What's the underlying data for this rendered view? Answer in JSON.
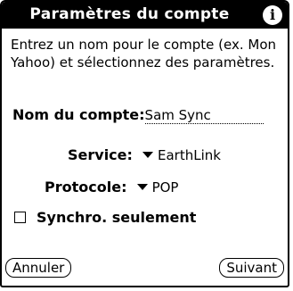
{
  "dialog": {
    "title": "Paramètres du compte",
    "instructions": "Entrez un nom pour le compte (ex. Mon Yahoo) et sélectionnez des paramètres."
  },
  "account_name": {
    "label": "Nom du compte:",
    "value": "Sam Sync"
  },
  "service": {
    "label": "Service:",
    "selected": "EarthLink"
  },
  "protocol": {
    "label": "Protocole:",
    "selected": "POP"
  },
  "sync_only": {
    "label": "Synchro. seulement",
    "checked": false
  },
  "buttons": {
    "cancel": "Annuler",
    "next": "Suivant"
  }
}
